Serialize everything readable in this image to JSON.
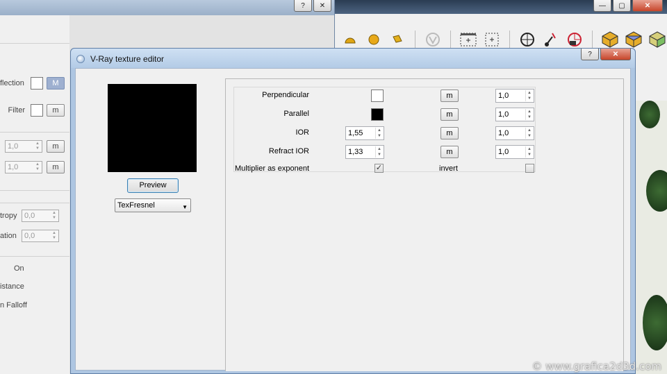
{
  "background_app": {
    "title_buttons": [
      "—",
      "▢",
      "✕"
    ]
  },
  "left_window": {
    "title_buttons": [
      "?",
      "✕"
    ],
    "rows": {
      "reflection_label": "flection",
      "reflection_button": "M",
      "filter_label": "Filter",
      "filter_button": "m",
      "spin1_value": "1,0",
      "spin1_button": "m",
      "spin2_value": "1,0",
      "spin2_button": "m",
      "anisotropy_label": "tropy",
      "anisotropy_value": "0,0",
      "rotation_label": "ation",
      "rotation_value": "0,0",
      "on_label": "On",
      "distance_label": "istance",
      "falloff_label": "n Falloff"
    }
  },
  "dialog": {
    "title": "V-Ray texture editor",
    "title_buttons": [
      "?",
      "✕"
    ],
    "preview_button": "Preview",
    "texture_type": "TexFresnel",
    "params": {
      "perpendicular": {
        "label": "Perpendicular",
        "color": "#ffffff",
        "m_label": "m",
        "multiplier": "1,0"
      },
      "parallel": {
        "label": "Parallel",
        "color": "#000000",
        "m_label": "m",
        "multiplier": "1,0"
      },
      "ior": {
        "label": "IOR",
        "value": "1,55",
        "m_label": "m",
        "multiplier": "1,0"
      },
      "refract_ior": {
        "label": "Refract IOR",
        "value": "1,33",
        "m_label": "m",
        "multiplier": "1,0"
      },
      "multiplier_as_exponent": {
        "label": "Multiplier as exponent",
        "checked": true,
        "mark": "✓"
      },
      "invert": {
        "label": "invert",
        "checked": false,
        "mark": ""
      }
    }
  },
  "watermark": "© www.grafica2d3d.com"
}
